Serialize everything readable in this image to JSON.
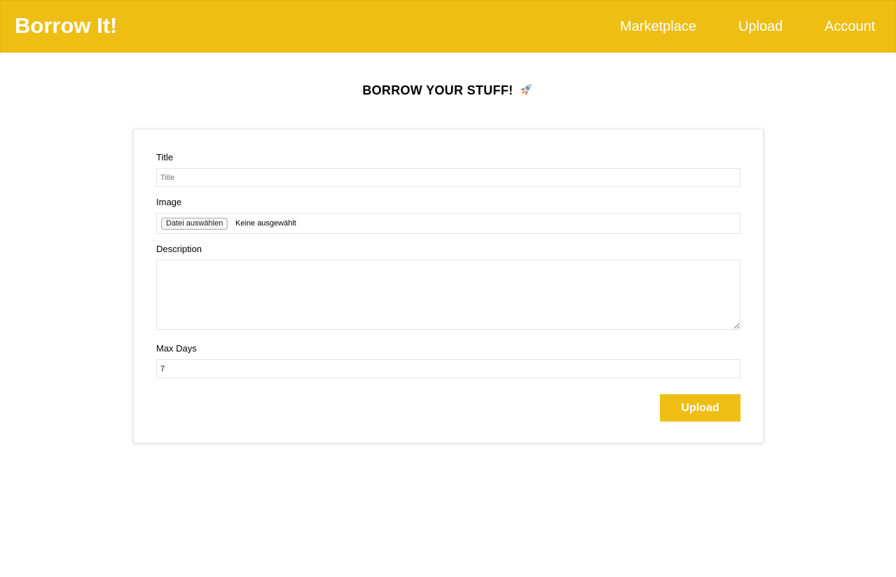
{
  "header": {
    "brand": "Borrow It!",
    "nav": {
      "marketplace": "Marketplace",
      "upload": "Upload",
      "account": "Account"
    },
    "background_color": "#efbe13"
  },
  "page": {
    "title": "BORROW YOUR STUFF!",
    "title_icon": "rocket-icon"
  },
  "form": {
    "title_label": "Title",
    "title_placeholder": "Title",
    "image_label": "Image",
    "file_button_label": "Datei auswählen",
    "file_status": "Keine ausgewählt",
    "description_label": "Description",
    "description_value": "",
    "max_days_label": "Max Days",
    "max_days_value": "7",
    "submit_label": "Upload",
    "accent_color": "#efbe13"
  }
}
